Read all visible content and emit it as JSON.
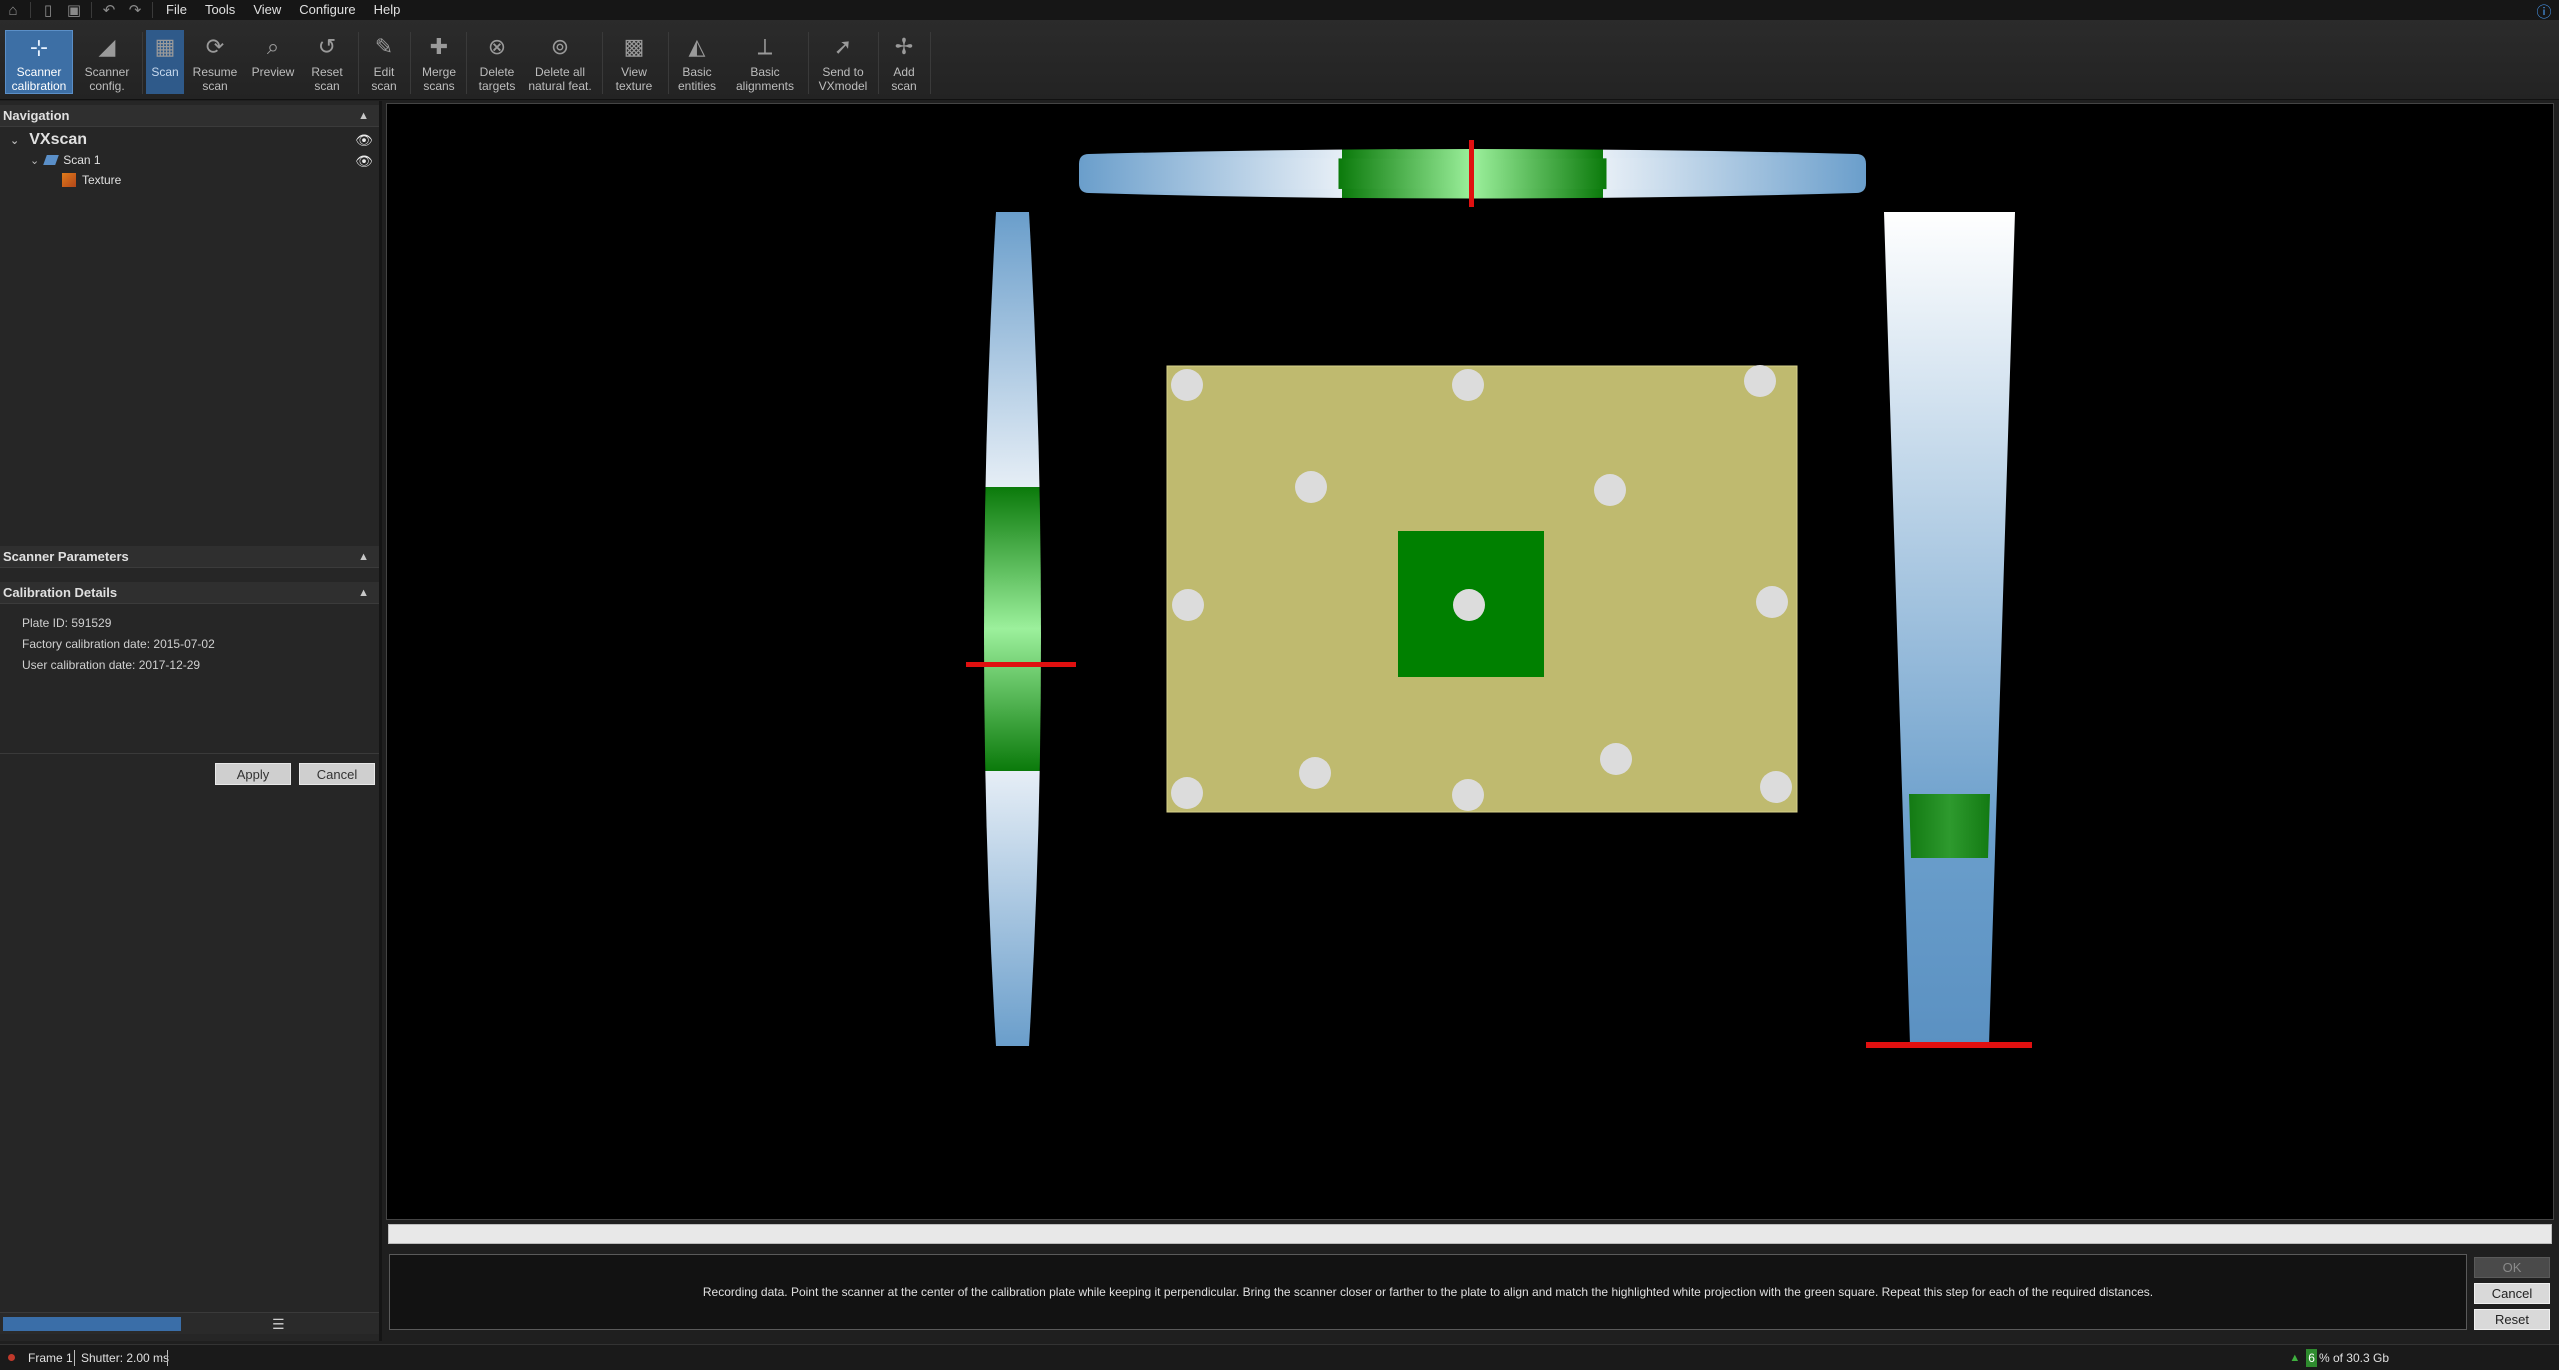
{
  "menu": {
    "items": [
      "File",
      "Tools",
      "View",
      "Configure",
      "Help"
    ]
  },
  "ribbon": {
    "buttons": [
      {
        "label1": "Scanner",
        "label2": "calibration",
        "icon": "calibration-icon",
        "state": "active"
      },
      {
        "label1": "Scanner",
        "label2": "config.",
        "icon": "scanner-config-icon",
        "state": "normal"
      },
      {
        "label1": "Scan",
        "label2": "",
        "icon": "scan-icon",
        "state": "pressed"
      },
      {
        "label1": "Resume",
        "label2": "scan",
        "icon": "resume-scan-icon",
        "state": "normal"
      },
      {
        "label1": "Preview",
        "label2": "",
        "icon": "preview-icon",
        "state": "normal"
      },
      {
        "label1": "Reset",
        "label2": "scan",
        "icon": "reset-scan-icon",
        "state": "normal"
      },
      {
        "label1": "Edit",
        "label2": "scan",
        "icon": "edit-scan-icon",
        "state": "normal"
      },
      {
        "label1": "Merge",
        "label2": "scans",
        "icon": "merge-scans-icon",
        "state": "normal"
      },
      {
        "label1": "Delete",
        "label2": "targets",
        "icon": "delete-targets-icon",
        "state": "normal"
      },
      {
        "label1": "Delete all",
        "label2": "natural feat.",
        "icon": "delete-natural-features-icon",
        "state": "normal"
      },
      {
        "label1": "View",
        "label2": "texture",
        "icon": "view-texture-icon",
        "state": "normal"
      },
      {
        "label1": "Basic",
        "label2": "entities",
        "icon": "basic-entities-icon",
        "state": "normal"
      },
      {
        "label1": "Basic",
        "label2": "alignments",
        "icon": "basic-alignments-icon",
        "state": "normal"
      },
      {
        "label1": "Send to",
        "label2": "VXmodel",
        "icon": "send-to-vxmodel-icon",
        "state": "normal"
      },
      {
        "label1": "Add",
        "label2": "scan",
        "icon": "add-scan-icon",
        "state": "normal"
      }
    ]
  },
  "navigation": {
    "title": "Navigation",
    "root": "VXscan",
    "scan": "Scan 1",
    "texture": "Texture"
  },
  "scanner_parameters": {
    "title": "Scanner Parameters"
  },
  "calibration_details": {
    "title": "Calibration Details",
    "plate_id": "Plate ID: 591529",
    "factory_date": "Factory calibration date: 2015-07-02",
    "user_date": "User calibration date: 2017-12-29",
    "apply": "Apply",
    "cancel": "Cancel"
  },
  "viewport": {
    "message": "Recording data. Point the scanner at the center of the calibration plate while keeping it perpendicular. Bring the scanner closer or farther to the plate to align and match the highlighted white projection with the green square. Repeat this step for each of the required distances.",
    "ok": "OK",
    "cancel": "Cancel",
    "reset": "Reset",
    "colors": {
      "plate": "#bfba6f",
      "green": "#008000",
      "indicator": "#e01010",
      "gauge_blue": "#6a9ecb"
    }
  },
  "status": {
    "frame": "Frame 1",
    "shutter": "Shutter: 2.00 ms",
    "memory_percent": "6",
    "memory_text": "% of 30.3 Gb"
  }
}
